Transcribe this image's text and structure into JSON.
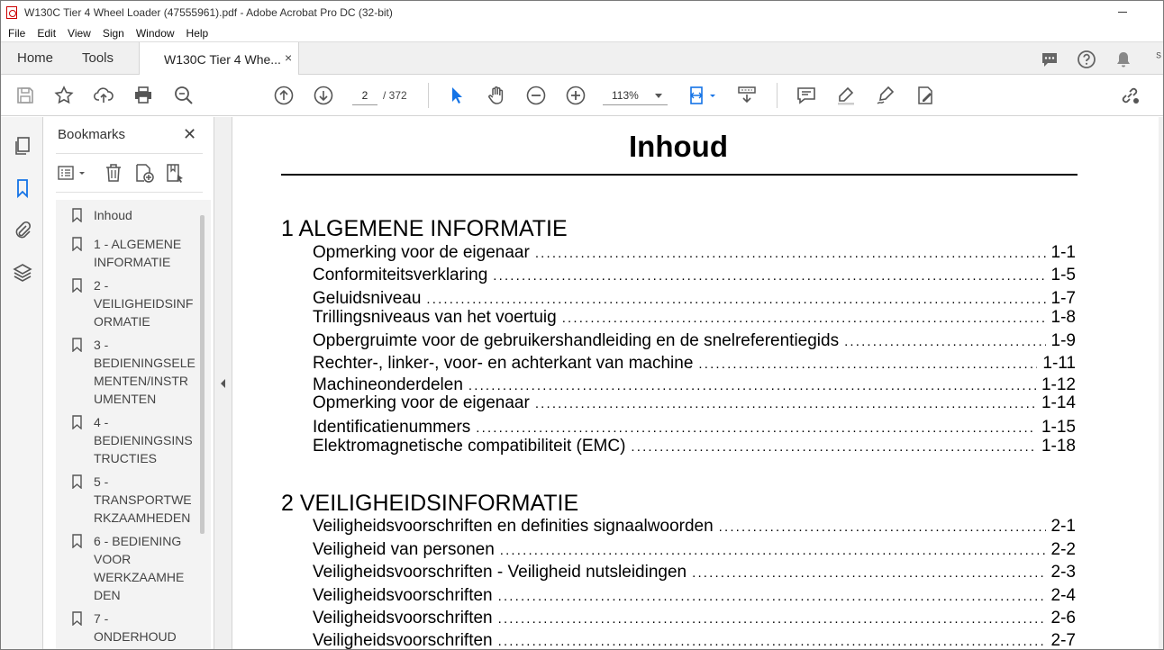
{
  "window": {
    "title": "W130C Tier 4 Wheel Loader (47555961).pdf - Adobe Acrobat Pro DC (32-bit)"
  },
  "menu": [
    "File",
    "Edit",
    "View",
    "Sign",
    "Window",
    "Help"
  ],
  "tabs": {
    "home": "Home",
    "tools": "Tools",
    "document": "W130C Tier 4 Whe...",
    "close": "×"
  },
  "toolbar": {
    "page_current": "2",
    "page_total": "/ 372",
    "zoom": "113%"
  },
  "bookmarks": {
    "header": "Bookmarks",
    "close": "✕",
    "items": [
      {
        "label": "Inhoud"
      },
      {
        "label": "1 - ALGEMENE\nINFORMATIE"
      },
      {
        "label": "2 -\nVEILIGHEIDSINF\nORMATIE"
      },
      {
        "label": "3 -\nBEDIENINGSELE\nMENTEN/INSTR\nUMENTEN"
      },
      {
        "label": "4 -\nBEDIENINGSINS\nTRUCTIES"
      },
      {
        "label": "5 -\nTRANSPORTWE\nRKZAAMHEDEN"
      },
      {
        "label": "6 - BEDIENING\nVOOR\nWERKZAAMHE\nDEN"
      },
      {
        "label": "7 -\nONDERHOUD"
      }
    ]
  },
  "document": {
    "title": "Inhoud",
    "sections": [
      {
        "heading": "1 ALGEMENE INFORMATIE",
        "entries": [
          {
            "text": "Opmerking voor de eigenaar",
            "page": "1-1"
          },
          {
            "text": "Conformiteitsverklaring",
            "page": "1-5"
          },
          {
            "text": "Geluidsniveau",
            "page": "1-7"
          },
          {
            "text": "Trillingsniveaus van het voertuig",
            "page": "1-8"
          },
          {
            "text": "Opbergruimte voor de gebruikershandleiding en de snelreferentiegids",
            "page": "1-9"
          },
          {
            "text": "Rechter-, linker-, voor- en achterkant van machine",
            "page": "1-11"
          },
          {
            "text": "Machineonderdelen",
            "page": "1-12"
          },
          {
            "text": "Opmerking voor de eigenaar",
            "page": "1-14"
          },
          {
            "text": "Identificatienummers",
            "page": "1-15"
          },
          {
            "text": "Elektromagnetische compatibiliteit (EMC)",
            "page": "1-18"
          }
        ]
      },
      {
        "heading": "2 VEILIGHEIDSINFORMATIE",
        "entries": [
          {
            "text": "Veiligheidsvoorschriften en definities signaalwoorden",
            "page": "2-1"
          },
          {
            "text": "Veiligheid van personen",
            "page": "2-2"
          },
          {
            "text": "Veiligheidsvoorschriften - Veiligheid nutsleidingen",
            "page": "2-3"
          },
          {
            "text": "Veiligheidsvoorschriften",
            "page": "2-4"
          },
          {
            "text": "Veiligheidsvoorschriften",
            "page": "2-6"
          },
          {
            "text": "Veiligheidsvoorschriften",
            "page": "2-7"
          }
        ]
      }
    ]
  }
}
